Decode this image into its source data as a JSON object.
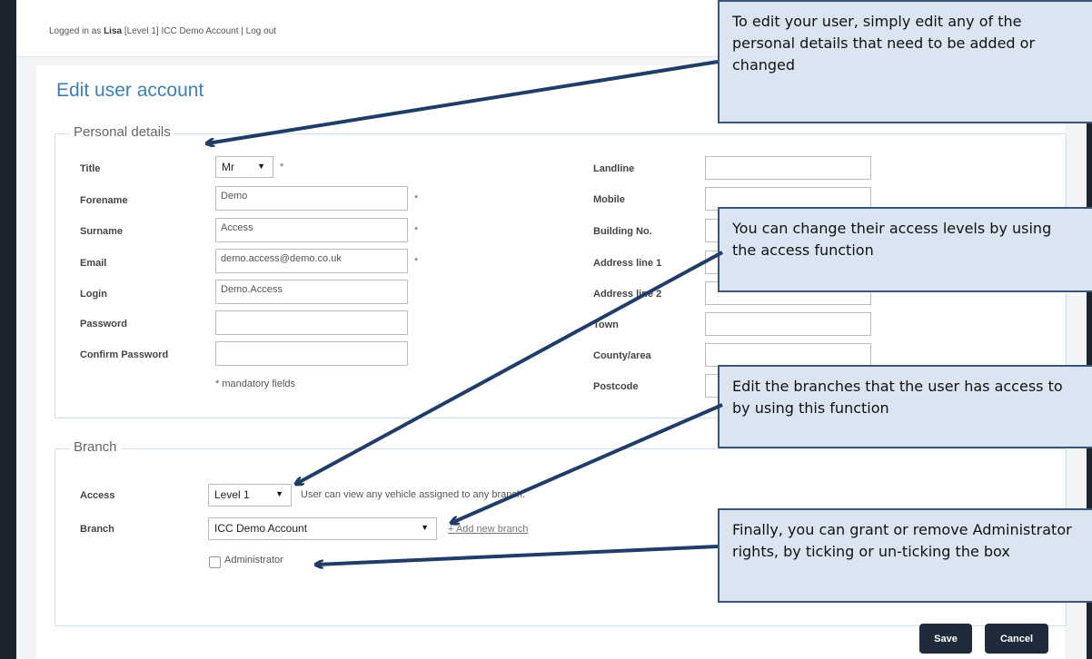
{
  "header": {
    "login_prefix": "Logged in as",
    "user": "Lisa",
    "level": "[Level 1]",
    "account": "ICC Demo Account",
    "separator": "|",
    "logout": "Log out"
  },
  "page_title": "Edit user account",
  "personal": {
    "legend": "Personal details",
    "title_label": "Title",
    "title_value": "Mr",
    "forename_label": "Forename",
    "forename_value": "Demo",
    "surname_label": "Surname",
    "surname_value": "Access",
    "email_label": "Email",
    "email_value": "demo.access@demo.co.uk",
    "login_label": "Login",
    "login_value": "Demo.Access",
    "password_label": "Password",
    "confirm_label": "Confirm Password",
    "mandatory_note": "* mandatory fields",
    "star": "*",
    "landline_label": "Landline",
    "mobile_label": "Mobile",
    "building_label": "Building No.",
    "addr1_label": "Address line 1",
    "addr2_label": "Address line 2",
    "town_label": "Town",
    "county_label": "County/area",
    "postcode_label": "Postcode"
  },
  "branch": {
    "legend": "Branch",
    "access_label": "Access",
    "access_value": "Level 1",
    "access_hint": "User can view any vehicle assigned to any branch.",
    "branch_label": "Branch",
    "branch_value": "ICC Demo Account",
    "add_branch": "+ Add new branch",
    "admin_label": "Administrator"
  },
  "buttons": {
    "save": "Save",
    "cancel": "Cancel"
  },
  "callouts": {
    "edit_details": "To edit your user, simply edit any of the personal details that need to be added or changed",
    "access_levels": "You can change their access levels by using the access function",
    "branches": "Edit the branches that the user has access to by using this function",
    "admin": "Finally, you can grant or remove Administrator rights, by ticking or un-ticking the box"
  },
  "icons": {
    "caret": "▼"
  },
  "colors": {
    "accent": "#3a7fb8",
    "callout_bg": "#dbe5f1",
    "callout_border": "#3b5578",
    "button": "#1f2b3a"
  }
}
